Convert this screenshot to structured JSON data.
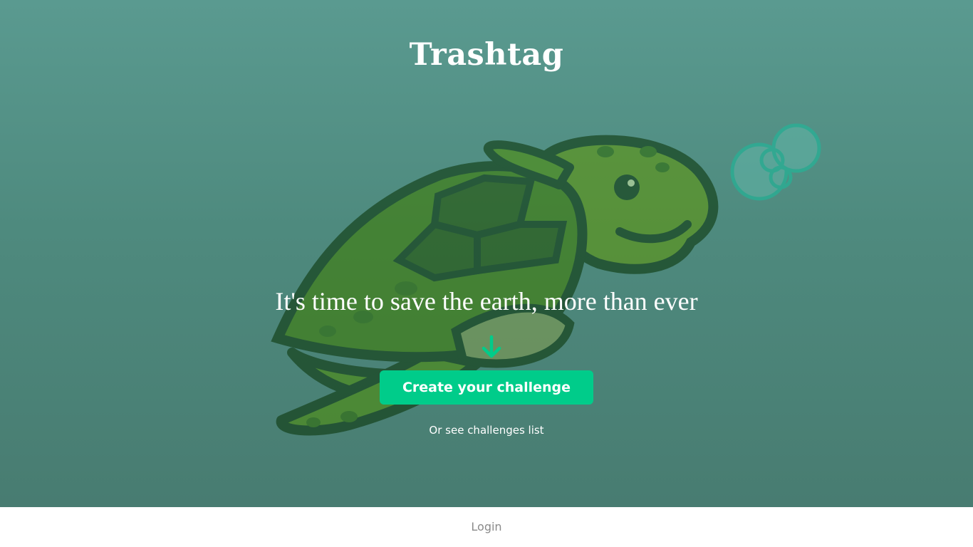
{
  "header": {
    "title": "Trashtag"
  },
  "hero": {
    "tagline": "It's time to save the earth, more than ever",
    "cta_label": "Create your challenge",
    "secondary_link": "Or see challenges list",
    "illustration_icon": "sea-turtle-icon",
    "arrow_icon": "arrow-down-icon"
  },
  "footer": {
    "login_label": "Login"
  },
  "colors": {
    "hero_background_top": "#5a9a90",
    "hero_background_bottom": "#487c71",
    "accent": "#00cc8a",
    "footer_background": "#ffffff",
    "footer_text": "#8a8a8a"
  }
}
